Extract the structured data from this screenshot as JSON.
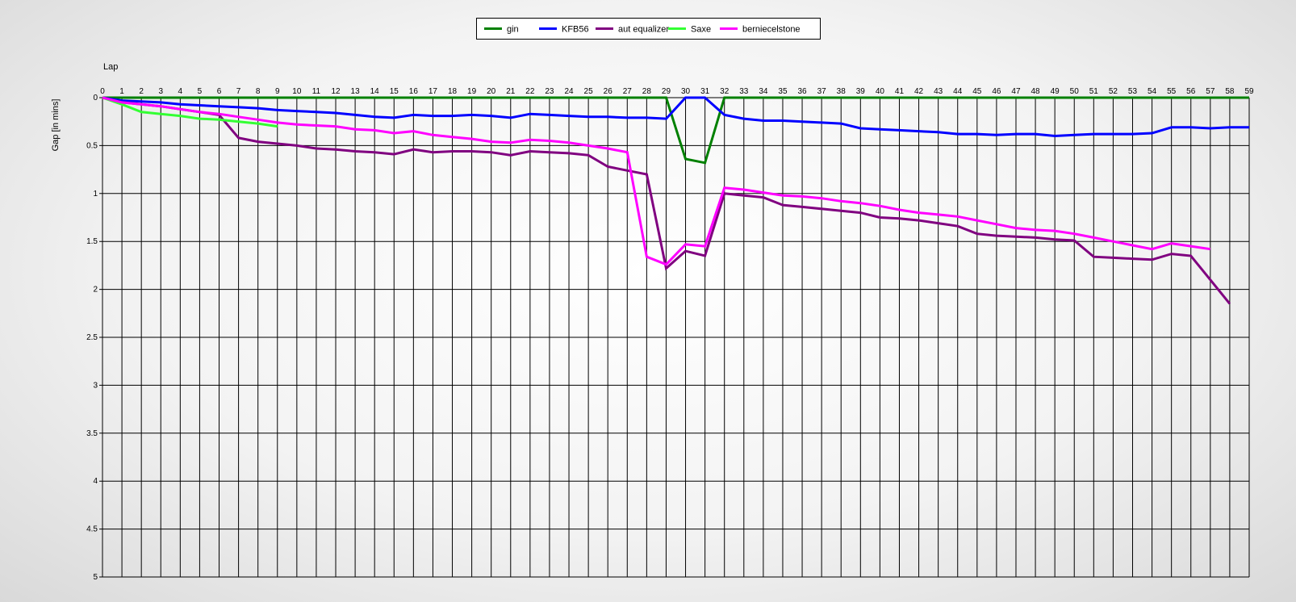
{
  "chart_data": {
    "type": "line",
    "xlabel": "Lap",
    "ylabel": "Gap [in mins]",
    "xlim": [
      0,
      59
    ],
    "ylim": [
      0,
      5
    ],
    "y_inverted": true,
    "x_ticks": [
      0,
      1,
      2,
      3,
      4,
      5,
      6,
      7,
      8,
      9,
      10,
      11,
      12,
      13,
      14,
      15,
      16,
      17,
      18,
      19,
      20,
      21,
      22,
      23,
      24,
      25,
      26,
      27,
      28,
      29,
      30,
      31,
      32,
      33,
      34,
      35,
      36,
      37,
      38,
      39,
      40,
      41,
      42,
      43,
      44,
      45,
      46,
      47,
      48,
      49,
      50,
      51,
      52,
      53,
      54,
      55,
      56,
      57,
      58,
      59
    ],
    "y_ticks": [
      0,
      0.5,
      1,
      1.5,
      2,
      2.5,
      3,
      3.5,
      4,
      4.5,
      5
    ],
    "grid": true,
    "legend_position": "top-center",
    "series": [
      {
        "name": "gin",
        "color": "#008000",
        "x": [
          0,
          1,
          2,
          3,
          4,
          5,
          6,
          7,
          8,
          9,
          10,
          11,
          12,
          13,
          14,
          15,
          16,
          17,
          18,
          19,
          20,
          21,
          22,
          23,
          24,
          25,
          26,
          27,
          28,
          29,
          30,
          31,
          32,
          33,
          34,
          35,
          36,
          37,
          38,
          39,
          40,
          41,
          42,
          43,
          44,
          45,
          46,
          47,
          48,
          49,
          50,
          51,
          52,
          53,
          54,
          55,
          56,
          57,
          58,
          59
        ],
        "y": [
          0,
          0,
          0,
          0,
          0,
          0,
          0,
          0,
          0,
          0,
          0,
          0,
          0,
          0,
          0,
          0,
          0,
          0,
          0,
          0,
          0,
          0,
          0,
          0,
          0,
          0,
          0,
          0,
          0,
          0,
          0.64,
          0.68,
          0,
          0,
          0,
          0,
          0,
          0,
          0,
          0,
          0,
          0,
          0,
          0,
          0,
          0,
          0,
          0,
          0,
          0,
          0,
          0,
          0,
          0,
          0,
          0,
          0,
          0,
          0,
          0
        ]
      },
      {
        "name": "KFB56",
        "color": "#0000ff",
        "x": [
          0,
          1,
          2,
          3,
          4,
          5,
          6,
          7,
          8,
          9,
          10,
          11,
          12,
          13,
          14,
          15,
          16,
          17,
          18,
          19,
          20,
          21,
          22,
          23,
          24,
          25,
          26,
          27,
          28,
          29,
          30,
          31,
          32,
          33,
          34,
          35,
          36,
          37,
          38,
          39,
          40,
          41,
          42,
          43,
          44,
          45,
          46,
          47,
          48,
          49,
          50,
          51,
          52,
          53,
          54,
          55,
          56,
          57,
          58,
          59
        ],
        "y": [
          0,
          0.03,
          0.04,
          0.05,
          0.07,
          0.08,
          0.09,
          0.1,
          0.11,
          0.13,
          0.14,
          0.15,
          0.16,
          0.18,
          0.2,
          0.21,
          0.18,
          0.19,
          0.19,
          0.18,
          0.19,
          0.21,
          0.17,
          0.18,
          0.19,
          0.2,
          0.2,
          0.21,
          0.21,
          0.22,
          0,
          0,
          0.18,
          0.22,
          0.24,
          0.24,
          0.25,
          0.26,
          0.27,
          0.32,
          0.33,
          0.34,
          0.35,
          0.36,
          0.38,
          0.38,
          0.39,
          0.38,
          0.38,
          0.4,
          0.39,
          0.38,
          0.38,
          0.38,
          0.37,
          0.31,
          0.31,
          0.32,
          0.31,
          0.31
        ]
      },
      {
        "name": "aut equalizer",
        "color": "#800080",
        "x": [
          0,
          1,
          2,
          3,
          4,
          5,
          6,
          7,
          8,
          9,
          10,
          11,
          12,
          13,
          14,
          15,
          16,
          17,
          18,
          19,
          20,
          21,
          22,
          23,
          24,
          25,
          26,
          27,
          28,
          29,
          30,
          31,
          32,
          33,
          34,
          35,
          36,
          37,
          38,
          39,
          40,
          41,
          42,
          43,
          44,
          45,
          46,
          47,
          48,
          49,
          50,
          51,
          52,
          53,
          54,
          55,
          56,
          57,
          58
        ],
        "y": [
          0,
          0.05,
          0.07,
          0.09,
          0.12,
          0.15,
          0.18,
          0.42,
          0.46,
          0.48,
          0.5,
          0.53,
          0.54,
          0.56,
          0.57,
          0.59,
          0.54,
          0.57,
          0.56,
          0.56,
          0.57,
          0.6,
          0.56,
          0.57,
          0.58,
          0.6,
          0.72,
          0.76,
          0.8,
          1.78,
          1.6,
          1.65,
          1,
          1.02,
          1.04,
          1.12,
          1.14,
          1.16,
          1.18,
          1.2,
          1.25,
          1.26,
          1.28,
          1.31,
          1.34,
          1.42,
          1.44,
          1.45,
          1.46,
          1.48,
          1.49,
          1.66,
          1.67,
          1.68,
          1.69,
          1.63,
          1.65,
          1.9,
          2.15
        ]
      },
      {
        "name": "Saxe",
        "color": "#33ff33",
        "x": [
          0,
          1,
          2,
          3,
          4,
          5,
          6,
          7,
          8,
          9
        ],
        "y": [
          0,
          0.07,
          0.15,
          0.17,
          0.19,
          0.22,
          0.23,
          0.25,
          0.27,
          0.3
        ]
      },
      {
        "name": "berniecelstone",
        "color": "#ff00ff",
        "x": [
          0,
          1,
          2,
          3,
          4,
          5,
          6,
          7,
          8,
          9,
          10,
          11,
          12,
          13,
          14,
          15,
          16,
          17,
          18,
          19,
          20,
          21,
          22,
          23,
          24,
          25,
          26,
          27,
          28,
          29,
          30,
          31,
          32,
          33,
          34,
          35,
          36,
          37,
          38,
          39,
          40,
          41,
          42,
          43,
          44,
          45,
          46,
          47,
          48,
          49,
          50,
          51,
          52,
          53,
          54,
          55,
          56,
          57
        ],
        "y": [
          0,
          0.05,
          0.07,
          0.09,
          0.12,
          0.15,
          0.17,
          0.2,
          0.23,
          0.26,
          0.28,
          0.29,
          0.3,
          0.33,
          0.34,
          0.37,
          0.35,
          0.39,
          0.41,
          0.43,
          0.46,
          0.47,
          0.44,
          0.45,
          0.47,
          0.5,
          0.53,
          0.57,
          1.66,
          1.74,
          1.53,
          1.55,
          0.94,
          0.96,
          0.99,
          1.02,
          1.03,
          1.05,
          1.08,
          1.1,
          1.13,
          1.17,
          1.2,
          1.22,
          1.24,
          1.28,
          1.32,
          1.36,
          1.38,
          1.39,
          1.42,
          1.46,
          1.5,
          1.54,
          1.58,
          1.52,
          1.55,
          1.58
        ]
      }
    ]
  }
}
